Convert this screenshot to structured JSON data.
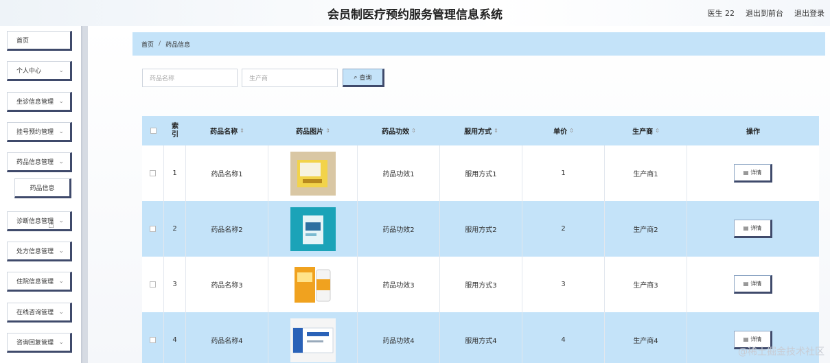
{
  "header": {
    "title": "会员制医疗预约服务管理信息系统",
    "user": "医生 22",
    "front_link": "退出到前台",
    "logout": "退出登录"
  },
  "sidebar": {
    "items": [
      {
        "label": "首页",
        "has_chevron": false
      },
      {
        "label": "个人中心",
        "has_chevron": true
      },
      {
        "label": "坐诊信息管理",
        "has_chevron": true
      },
      {
        "label": "挂号预约管理",
        "has_chevron": true
      },
      {
        "label": "药品信息管理",
        "has_chevron": true
      },
      {
        "label": "药品信息",
        "sub": true
      },
      {
        "label": "诊断信息管理",
        "has_chevron": true
      },
      {
        "label": "处方信息管理",
        "has_chevron": true
      },
      {
        "label": "住院信息管理",
        "has_chevron": true
      },
      {
        "label": "在线咨询管理",
        "has_chevron": true
      },
      {
        "label": "咨询回复管理",
        "has_chevron": true
      }
    ]
  },
  "breadcrumb": {
    "home": "首页",
    "sep": "/",
    "current": "药品信息"
  },
  "search": {
    "name_placeholder": "药品名称",
    "maker_placeholder": "生产商",
    "button": "查询"
  },
  "table": {
    "headers": {
      "index": "索引",
      "name": "药品名称",
      "image": "药品图片",
      "effect": "药品功效",
      "usage": "服用方式",
      "price": "单价",
      "maker": "生产商",
      "action": "操作"
    },
    "rows": [
      {
        "index": "1",
        "name": "药品名称1",
        "effect": "药品功效1",
        "usage": "服用方式1",
        "price": "1",
        "maker": "生产商1",
        "action": "详情"
      },
      {
        "index": "2",
        "name": "药品名称2",
        "effect": "药品功效2",
        "usage": "服用方式2",
        "price": "2",
        "maker": "生产商2",
        "action": "详情"
      },
      {
        "index": "3",
        "name": "药品名称3",
        "effect": "药品功效3",
        "usage": "服用方式3",
        "price": "3",
        "maker": "生产商3",
        "action": "详情"
      },
      {
        "index": "4",
        "name": "药品名称4",
        "effect": "药品功效4",
        "usage": "服用方式4",
        "price": "4",
        "maker": "生产商4",
        "action": "详情"
      }
    ]
  },
  "watermark": "@稀土掘金技术社区",
  "colors": {
    "accent": "#c4e3f9",
    "border_dark": "#3f4a6b"
  }
}
